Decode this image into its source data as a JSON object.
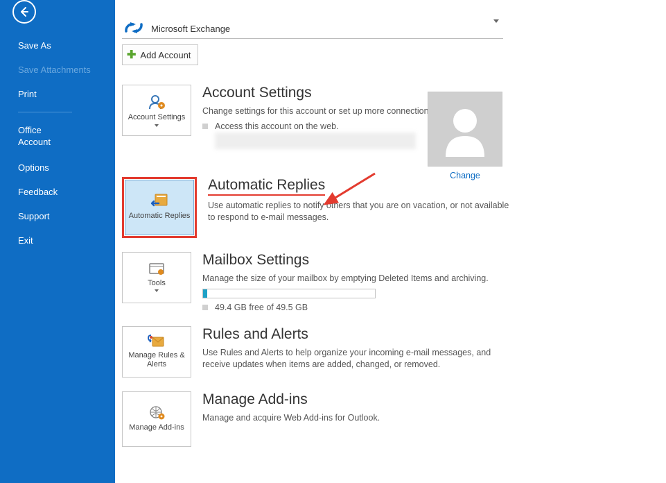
{
  "sidebar": {
    "save_as": "Save As",
    "save_attachments": "Save Attachments",
    "print": "Print",
    "office_account": "Office\nAccount",
    "options": "Options",
    "feedback": "Feedback",
    "support": "Support",
    "exit": "Exit"
  },
  "account_selector": {
    "label": "Microsoft Exchange"
  },
  "add_account_btn": "Add Account",
  "avatar": {
    "change": "Change"
  },
  "sections": {
    "account_settings": {
      "tile": "Account Settings",
      "title": "Account Settings",
      "subtitle": "Change settings for this account or set up more connections.",
      "bullet": "Access this account on the web."
    },
    "automatic_replies": {
      "tile": "Automatic Replies",
      "title": "Automatic Replies",
      "subtitle": "Use automatic replies to notify others that you are on vacation, or not available to respond to e-mail messages."
    },
    "mailbox_settings": {
      "tile": "Tools",
      "title": "Mailbox Settings",
      "subtitle": "Manage the size of your mailbox by emptying Deleted Items and archiving.",
      "quota": "49.4 GB free of 49.5 GB"
    },
    "rules_alerts": {
      "tile": "Manage Rules & Alerts",
      "title": "Rules and Alerts",
      "subtitle": "Use Rules and Alerts to help organize your incoming e-mail messages, and receive updates when items are added, changed, or removed."
    },
    "manage_addins": {
      "tile": "Manage Add-ins",
      "title": "Manage Add-ins",
      "subtitle": "Manage and acquire Web Add-ins for Outlook."
    }
  }
}
